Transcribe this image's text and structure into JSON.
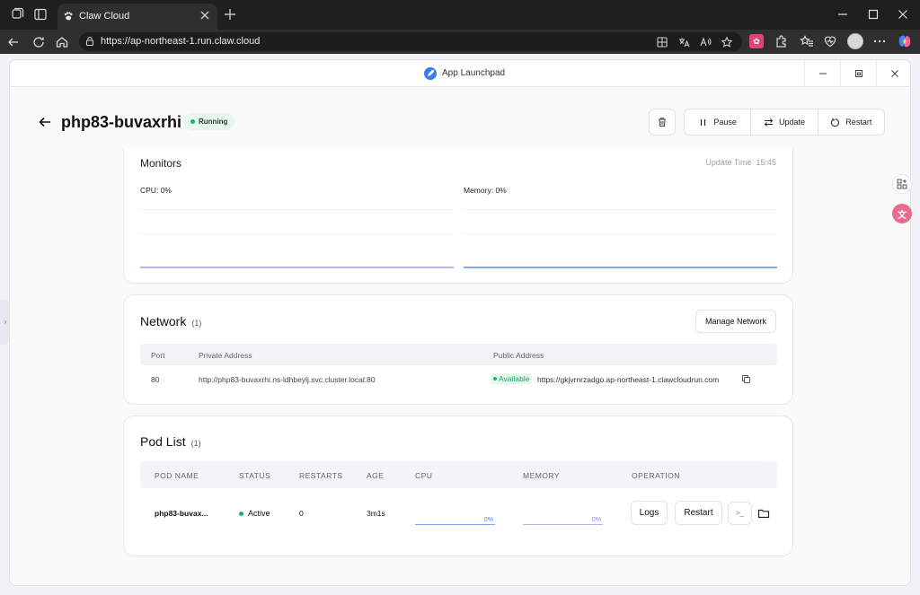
{
  "browser": {
    "tab_title": "Claw Cloud",
    "url": "https://ap-northeast-1.run.claw.cloud"
  },
  "window": {
    "title": "App Launchpad"
  },
  "app": {
    "name": "php83-buvaxrhi",
    "status": "Running",
    "actions": {
      "pause": "Pause",
      "update": "Update",
      "restart": "Restart"
    }
  },
  "monitors": {
    "title": "Monitors",
    "update_label": "Update Time",
    "update_time": "15:45",
    "cpu_label": "CPU:",
    "cpu_value": "0%",
    "memory_label": "Memory:",
    "memory_value": "0%",
    "colors": {
      "cpu_line": "#b9b4ea",
      "memory_line": "#7fa8e6"
    }
  },
  "network": {
    "title": "Network",
    "count": "(1)",
    "manage_label": "Manage Network",
    "headers": {
      "port": "Port",
      "private": "Private Address",
      "public": "Public Address"
    },
    "row": {
      "port": "80",
      "private": "http://php83-buvaxrhi.ns-ldhbeylj.svc.cluster.local:80",
      "availability": "Available",
      "public": "https://gkjvrnrzadgo.ap-northeast-1.clawcloudrun.com"
    }
  },
  "pods": {
    "title": "Pod List",
    "count": "(1)",
    "headers": {
      "name": "POD NAME",
      "status": "STATUS",
      "restarts": "RESTARTS",
      "age": "AGE",
      "cpu": "CPU",
      "memory": "MEMORY",
      "operation": "OPERATION"
    },
    "row": {
      "name": "php83-buvax...",
      "status": "Active",
      "restarts": "0",
      "age": "3m1s",
      "cpu": "0%",
      "memory": "0%",
      "logs_label": "Logs",
      "restart_label": "Restart",
      "terminal_glyph": ">_"
    }
  },
  "accent_colors": {
    "running": "#1fb366",
    "running_bg": "#e8f7ee"
  }
}
